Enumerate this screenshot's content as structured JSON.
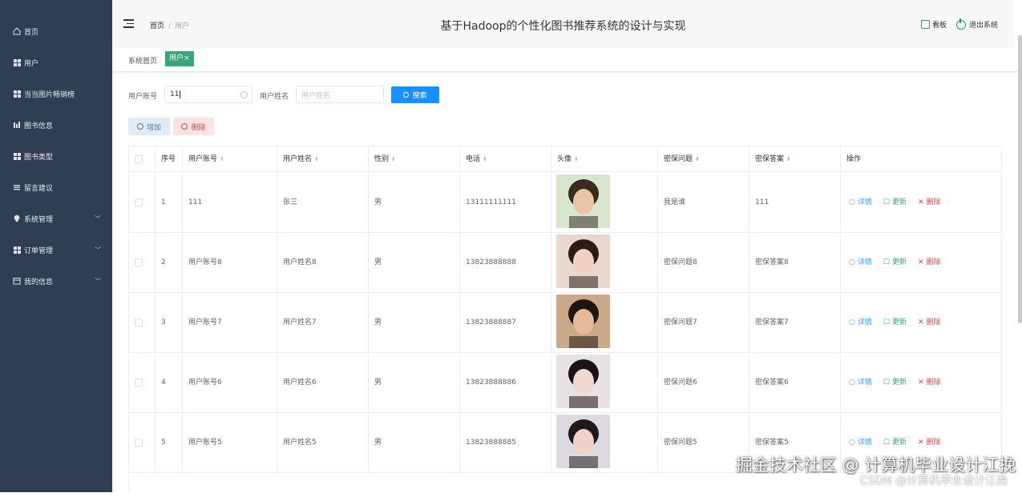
{
  "sidebar": {
    "items": [
      {
        "label": "首页",
        "icon": "home-icon"
      },
      {
        "label": "用户",
        "icon": "grid-icon"
      },
      {
        "label": "当当图片畅销榜",
        "icon": "grid-icon"
      },
      {
        "label": "图书信息",
        "icon": "bar-chart-icon"
      },
      {
        "label": "图书类型",
        "icon": "grid-icon"
      },
      {
        "label": "留言建议",
        "icon": "list-icon"
      },
      {
        "label": "系统管理",
        "icon": "bulb-icon",
        "expandable": true
      },
      {
        "label": "订单管理",
        "icon": "grid-icon",
        "expandable": true
      },
      {
        "label": "我的信息",
        "icon": "calendar-icon",
        "expandable": true
      }
    ]
  },
  "header": {
    "title": "基于Hadoop的个性化图书推荐系统的设计与实现",
    "breadcrumb": {
      "home": "首页",
      "separator": "/",
      "current": "用户"
    },
    "board": "看板",
    "logout": "退出系统"
  },
  "tags": {
    "home": "系统首页",
    "active": "用户",
    "close": "×"
  },
  "search": {
    "account_label": "用户账号",
    "account_value": "11",
    "name_label": "用户姓名",
    "name_placeholder": "用户姓名",
    "button": "搜索"
  },
  "actions": {
    "add": "增加",
    "delete": "删除"
  },
  "table": {
    "columns": [
      "序号",
      "用户账号",
      "用户姓名",
      "性别",
      "电话",
      "头像",
      "密保问题",
      "密保答案",
      "操作"
    ],
    "ops": {
      "view": "详情",
      "update": "更新",
      "delete": "删除"
    },
    "rows": [
      {
        "index": "1",
        "account": "111",
        "name": "张三",
        "gender": "男",
        "phone": "13111111111",
        "question": "我是谁",
        "answer": "111"
      },
      {
        "index": "2",
        "account": "用户账号8",
        "name": "用户姓名8",
        "gender": "男",
        "phone": "13823888888",
        "question": "密保问题8",
        "answer": "密保答案8"
      },
      {
        "index": "3",
        "account": "用户账号7",
        "name": "用户姓名7",
        "gender": "男",
        "phone": "13823888887",
        "question": "密保问题7",
        "answer": "密保答案7"
      },
      {
        "index": "4",
        "account": "用户账号6",
        "name": "用户姓名6",
        "gender": "男",
        "phone": "13823888886",
        "question": "密保问题6",
        "answer": "密保答案6"
      },
      {
        "index": "5",
        "account": "用户账号5",
        "name": "用户姓名5",
        "gender": "男",
        "phone": "13823888885",
        "question": "密保问题5",
        "answer": "密保答案5"
      }
    ]
  },
  "watermark": {
    "main": "掘金技术社区 @ 计算机毕业设计江挽",
    "sub": "CSDN @计算机毕业设计江挽"
  },
  "colors": {
    "sidebar_bg": "#2f3e52",
    "accent_green": "#3aa57b",
    "primary_blue": "#1890ff",
    "danger": "#c0504d"
  }
}
